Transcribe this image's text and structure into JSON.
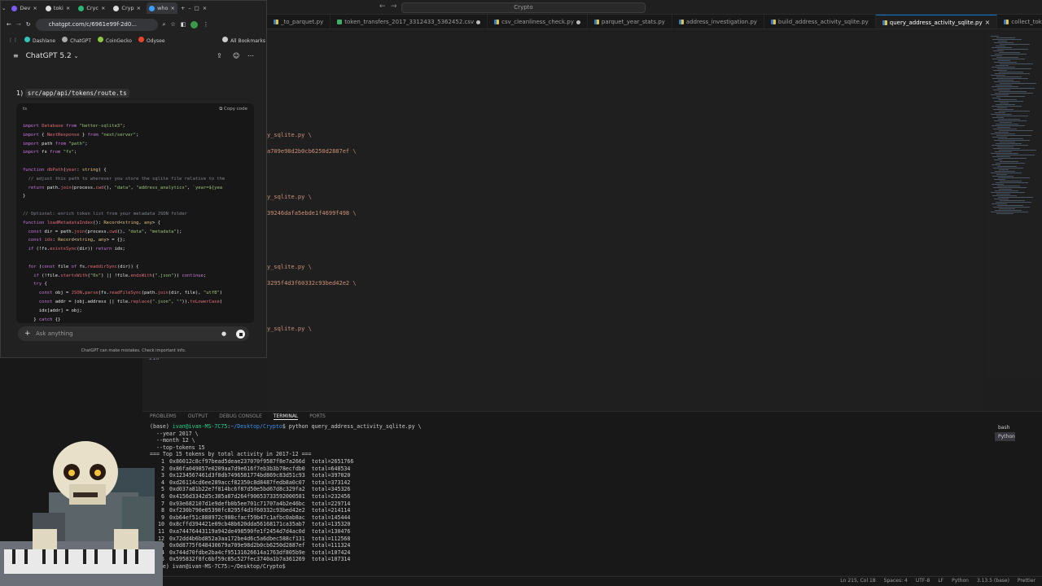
{
  "vscode": {
    "search": "Crypto",
    "tabs": [
      {
        "label": "_to_parquet.py",
        "type": "py",
        "active": false
      },
      {
        "label": "token_transfers_2017_3312433_5362452.csv",
        "type": "csv",
        "active": false
      },
      {
        "label": "csv_cleanliness_check.py",
        "type": "py",
        "active": false
      },
      {
        "label": "parquet_year_stats.py",
        "type": "py",
        "active": false
      },
      {
        "label": "address_investigation.py",
        "type": "py",
        "active": false
      },
      {
        "label": "build_address_activity_sqlite.py",
        "type": "py",
        "active": false
      },
      {
        "label": "query_address_activity_sqlite.py",
        "type": "py",
        "active": true
      },
      {
        "label": "collect_token_metadata.py",
        "type": "py",
        "active": false
      }
    ],
    "editor_fragments": [
      "y_sqlite.py \\",
      "a709e98d2b0cb6250d2887ef \\",
      "y_sqlite.py \\",
      "39246dafa5ebde1f4699f498 \\",
      "y_sqlite.py \\",
      "3295f4d3f60332c93bed42e2 \\",
      "y_sqlite.py \\"
    ],
    "line_number": "210",
    "panel_tabs": [
      "PROBLEMS",
      "OUTPUT",
      "DEBUG CONSOLE",
      "TERMINAL",
      "PORTS"
    ],
    "terminal": {
      "prompt_user": "ivan@ivan-MS-7C75",
      "prompt_path": "~/Desktop/Crypto",
      "command": "python query_address_activity_sqlite.py \\",
      "args": [
        "--year 2017 \\",
        "--month 12 \\",
        "--top-tokens 15"
      ],
      "header": "=== Top 15 tokens by total activity in 2017-12 ===",
      "rows": [
        [
          "1",
          "0x86012c8cf97bead5deae237070f9587f8e7a266d",
          "total=2651766"
        ],
        [
          "2",
          "0x86fa049857e0209aa7d9e616f7eb3b3b78ecfdb0",
          "total=648534"
        ],
        [
          "3",
          "0x1234567461d3f8db7496581774bd869c83d51c93",
          "total=397020"
        ],
        [
          "4",
          "0xd26114cd6ee289accf82350c8d8487fedb8a0c07",
          "total=373142"
        ],
        [
          "5",
          "0xd037a81b22e7f814bc6f87d50e5bd67d8c329fa2",
          "total=345326"
        ],
        [
          "6",
          "0x4156d3342d5c385a87d264f90653733592000581",
          "total=232456"
        ],
        [
          "7",
          "0x93e682107d1e9defb0b5ee701c71707a4b2e46bc",
          "total=229714"
        ],
        [
          "8",
          "0xf230b790e05390fc8295f4d3f60332c93bed42e2",
          "total=214114"
        ],
        [
          "9",
          "0xb64ef51c888972c908cfacf59b47c1afbc0ab8ac",
          "total=145444"
        ],
        [
          "10",
          "0x8cffd394421e09cb48b620dda56168171ca35ab7",
          "total=135320"
        ],
        [
          "11",
          "0xa74476443119a942de498590fe1f2454d7d4ac0d",
          "total=130476"
        ],
        [
          "12",
          "0x72dd4b6bd852a3aa172be4d6c5a6dbec588cf131",
          "total=112568"
        ],
        [
          "13",
          "0x0d8775f648430679a709e98d2b0cb6250d2887ef",
          "total=111324"
        ],
        [
          "14",
          "0x744d70fdbe2ba4cf95131626614a1763df805b9e",
          "total=107424"
        ],
        [
          "15",
          "0x595832f8fc6bf59c85c527fec3740a1b7a361269",
          "total=107314"
        ]
      ],
      "last_prompt": "(base) ivan@ivan-MS-7C75:~/Desktop/Crypto$"
    },
    "terminal_list": [
      "bash",
      "Python"
    ],
    "status": [
      "Ln 215, Col 18",
      "Spaces: 4",
      "UTF-8",
      "LF",
      "Python",
      "3.13.5 (base)",
      "Prettier"
    ]
  },
  "chrome": {
    "tabs": [
      "Dev",
      "toki",
      "Cryc",
      "Cryp",
      "who"
    ],
    "url": "chatgpt.com/c/6961e99f-2d0...",
    "bookmarks": [
      "Dashlane",
      "ChatGPT",
      "CoinGecko",
      "Odysee",
      "All Bookmarks"
    ],
    "model": "ChatGPT 5.2",
    "file_heading_num": "1)",
    "file_heading": "src/app/api/tokens/route.ts",
    "code_lang": "ts",
    "copy_label": "Copy code",
    "ask_placeholder": "Ask anything",
    "disclaimer": "ChatGPT can make mistakes. Check important info."
  }
}
